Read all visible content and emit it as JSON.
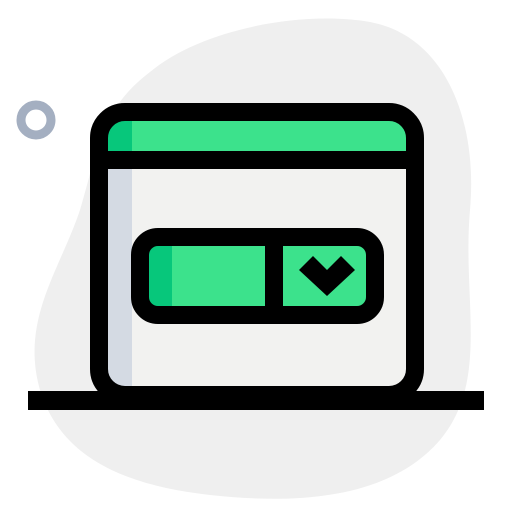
{
  "icon": {
    "name": "browser-window-dropdown",
    "colors": {
      "blob": "#efefef",
      "ring": "#a4afc1",
      "outline": "#000000",
      "accent": "#3ce28c",
      "accent_shade": "#07c77b",
      "window_fill": "#f2f2f0",
      "window_shade": "#d4dae3"
    }
  }
}
